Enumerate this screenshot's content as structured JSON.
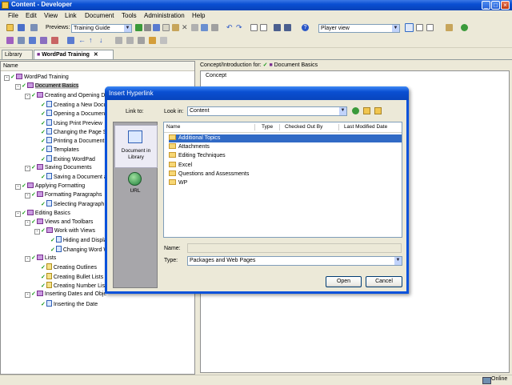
{
  "window": {
    "title": "Content - Developer"
  },
  "menu": [
    "File",
    "Edit",
    "View",
    "Link",
    "Document",
    "Tools",
    "Administration",
    "Help"
  ],
  "toolbar": {
    "previews_label": "Previews:",
    "previews_value": "Training Guide",
    "view_value": "Player view"
  },
  "tabs": {
    "library": "Library",
    "wordpad": "WordPad Training"
  },
  "tree": {
    "header": "Name",
    "items": [
      "WordPad Training",
      "Document Basics",
      "Creating and Opening Do",
      "Creating a New Docu",
      "Opening a Document",
      "Using Print Preview",
      "Changing the Page S",
      "Printing a Document",
      "Templates",
      "Exiting WordPad",
      "Saving Documents",
      "Saving a Document an",
      "Applying Formatting",
      "Formatting Paragraphs",
      "Selecting Paragraph T",
      "Editing Basics",
      "Views and Toolbars",
      "Work with Views",
      "Hiding and Display",
      "Changing Word W",
      "Lists",
      "Creating Outlines",
      "Creating Bullet Lists",
      "Creating Number Lists",
      "Inserting Dates and Obje",
      "Inserting the Date"
    ]
  },
  "concept": {
    "header_prefix": "Concept/Introduction for:",
    "header_doc": "Document Basics",
    "tab": "Concept"
  },
  "dialog": {
    "title": "Insert Hyperlink",
    "link_to": "Link to:",
    "places": {
      "library": "Document in Library",
      "url": "URL"
    },
    "look_in_label": "Look in:",
    "look_in_value": "Content",
    "columns": [
      "Name",
      "Type",
      "Checked Out By",
      "Last Modified Date"
    ],
    "files": [
      "Additional Topics",
      "Attachments",
      "Editing Techniques",
      "Excel",
      "Questions and Assessments",
      "WP"
    ],
    "name_label": "Name:",
    "name_value": "",
    "type_label": "Type:",
    "type_value": "Packages and Web Pages",
    "open": "Open",
    "cancel": "Cancel"
  },
  "status": {
    "online": "Online"
  },
  "colors": {
    "title_bar": "#0A4FD2",
    "selection": "#316AC5",
    "checkmark": "#1A9A1A"
  }
}
